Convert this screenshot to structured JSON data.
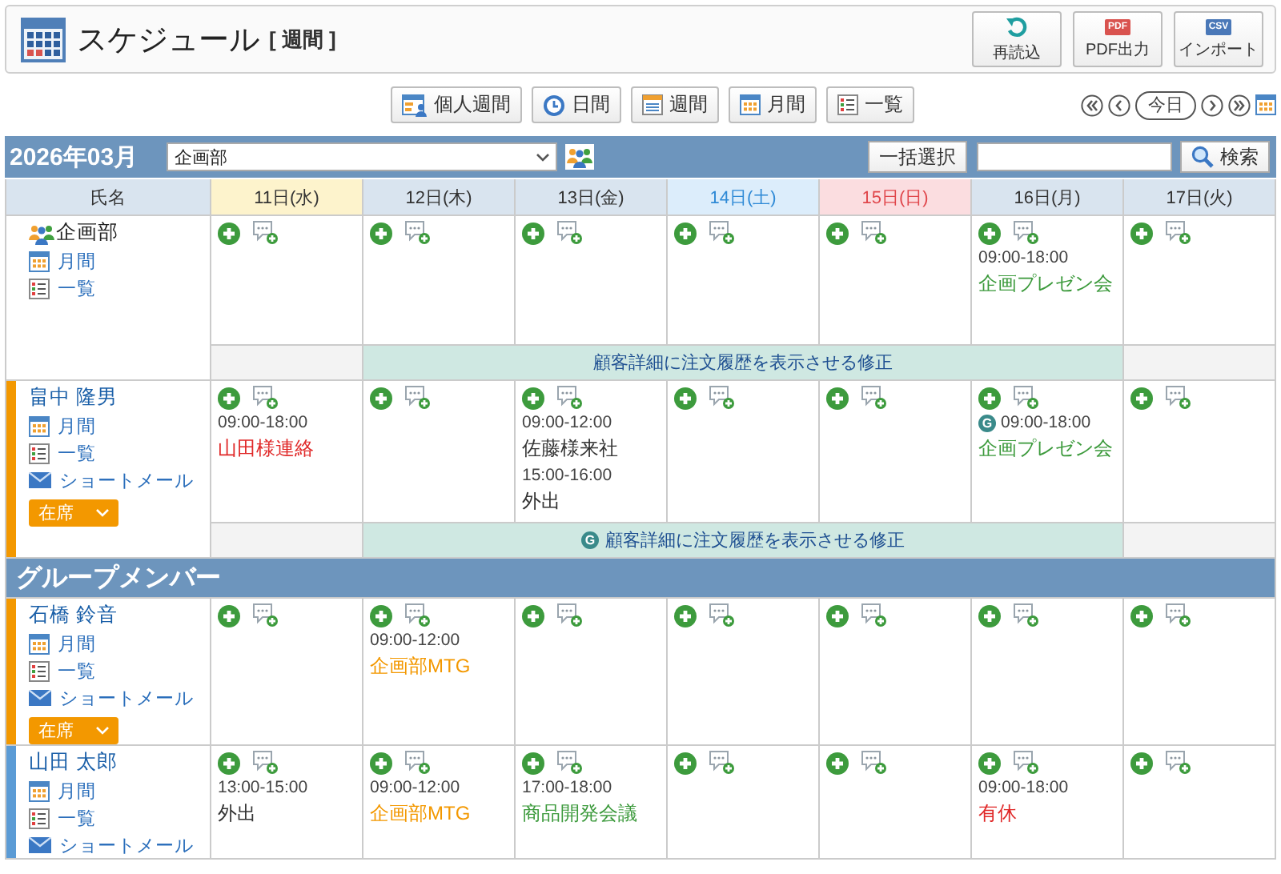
{
  "header": {
    "title": "スケジュール",
    "view": "[ 週間 ]",
    "actions": [
      {
        "label": "再読込",
        "kind": "reload"
      },
      {
        "label": "PDF出力",
        "kind": "pdf",
        "badge": "PDF"
      },
      {
        "label": "インポート",
        "kind": "csv",
        "badge": "CSV"
      }
    ]
  },
  "views": [
    {
      "label": "個人週間",
      "kind": "personal"
    },
    {
      "label": "日間",
      "kind": "day"
    },
    {
      "label": "週間",
      "kind": "week"
    },
    {
      "label": "月間",
      "kind": "month"
    },
    {
      "label": "一覧",
      "kind": "list"
    }
  ],
  "nav": {
    "today": "今日"
  },
  "toolbar": {
    "month": "2026年03月",
    "group": "企画部",
    "bulk": "一括選択",
    "search": "検索"
  },
  "columns": [
    {
      "label": "氏名",
      "kind": "name"
    },
    {
      "label": "11日(水)",
      "kind": "today"
    },
    {
      "label": "12日(木)",
      "kind": "weekday"
    },
    {
      "label": "13日(金)",
      "kind": "weekday"
    },
    {
      "label": "14日(土)",
      "kind": "saturday"
    },
    {
      "label": "15日(日)",
      "kind": "sunday"
    },
    {
      "label": "16日(月)",
      "kind": "weekday"
    },
    {
      "label": "17日(火)",
      "kind": "weekday"
    }
  ],
  "rows": [
    {
      "kind": "group",
      "name": "企画部",
      "links": [
        {
          "label": "月間",
          "kind": "month"
        },
        {
          "label": "一覧",
          "kind": "list"
        }
      ],
      "days": [
        {
          "add_buttons": true
        },
        {
          "add_buttons": true
        },
        {
          "add_buttons": true
        },
        {
          "add_buttons": true
        },
        {
          "add_buttons": true
        },
        {
          "add_buttons": true,
          "events": [
            {
              "time": "09:00-18:00",
              "title": "企画プレゼン会",
              "color": "#3c9a3c"
            }
          ]
        },
        {
          "add_buttons": true
        }
      ],
      "banner": {
        "text": "顧客詳細に注文履歴を表示させる修正",
        "days": [
          false,
          true,
          true,
          true,
          true,
          true,
          false
        ]
      }
    },
    {
      "kind": "member",
      "name": "畠中 隆男",
      "color": "#f39800",
      "status": "在席",
      "links": [
        {
          "label": "月間",
          "kind": "month"
        },
        {
          "label": "一覧",
          "kind": "list"
        },
        {
          "label": "ショートメール",
          "kind": "mail"
        }
      ],
      "days": [
        {
          "add_buttons": true,
          "events": [
            {
              "time": "09:00-18:00",
              "title": "山田様連絡",
              "color": "#e02828"
            }
          ]
        },
        {
          "add_buttons": true
        },
        {
          "add_buttons": true,
          "events": [
            {
              "time": "09:00-12:00",
              "title": "佐藤様来社",
              "color": "#333333"
            },
            {
              "time": "15:00-16:00",
              "title": "外出",
              "color": "#333333"
            }
          ]
        },
        {
          "add_buttons": true
        },
        {
          "add_buttons": true
        },
        {
          "add_buttons": true,
          "events": [
            {
              "badge": "G",
              "time": "09:00-18:00",
              "title": "企画プレゼン会",
              "color": "#3c9a3c"
            }
          ]
        },
        {
          "add_buttons": true
        }
      ],
      "banner": {
        "badge": "G",
        "text": "顧客詳細に注文履歴を表示させる修正",
        "days": [
          false,
          true,
          true,
          true,
          true,
          true,
          false
        ]
      }
    }
  ],
  "section": "グループメンバー",
  "members": [
    {
      "kind": "member",
      "name": "石橋 鈴音",
      "color": "#f39800",
      "status": "在席",
      "links": [
        {
          "label": "月間",
          "kind": "month"
        },
        {
          "label": "一覧",
          "kind": "list"
        },
        {
          "label": "ショートメール",
          "kind": "mail"
        }
      ],
      "days": [
        {
          "add_buttons": true
        },
        {
          "add_buttons": true,
          "events": [
            {
              "time": "09:00-12:00",
              "title": "企画部MTG",
              "color": "#f39800"
            }
          ]
        },
        {
          "add_buttons": true
        },
        {
          "add_buttons": true
        },
        {
          "add_buttons": true
        },
        {
          "add_buttons": true
        },
        {
          "add_buttons": true
        }
      ]
    },
    {
      "kind": "member",
      "name": "山田 太郎",
      "color": "#5b9bd5",
      "links": [
        {
          "label": "月間",
          "kind": "month"
        },
        {
          "label": "一覧",
          "kind": "list"
        },
        {
          "label": "ショートメール",
          "kind": "mail"
        }
      ],
      "days": [
        {
          "add_buttons": true,
          "events": [
            {
              "time": "13:00-15:00",
              "title": "外出",
              "color": "#333333"
            }
          ]
        },
        {
          "add_buttons": true,
          "events": [
            {
              "time": "09:00-12:00",
              "title": "企画部MTG",
              "color": "#f39800"
            }
          ]
        },
        {
          "add_buttons": true,
          "events": [
            {
              "time": "17:00-18:00",
              "title": "商品開発会議",
              "color": "#3c9a3c"
            }
          ]
        },
        {
          "add_buttons": true
        },
        {
          "add_buttons": true
        },
        {
          "add_buttons": true,
          "events": [
            {
              "time": "09:00-18:00",
              "title": "有休",
              "color": "#e02828"
            }
          ]
        },
        {
          "add_buttons": true
        }
      ]
    }
  ]
}
